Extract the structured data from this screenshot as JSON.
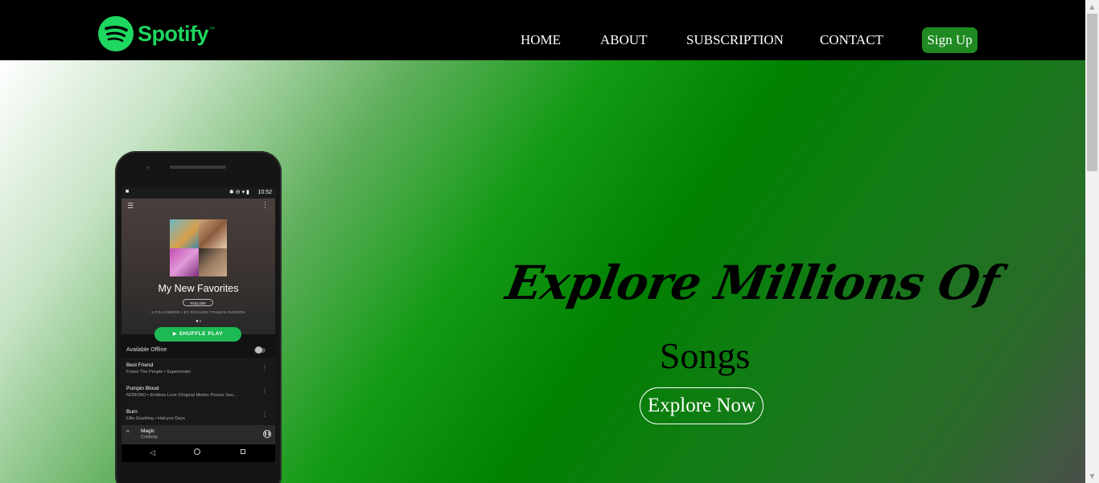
{
  "brand": {
    "name": "Spotify",
    "trademark": "™",
    "color": "#1ed760",
    "icon": "spotify-logo-icon"
  },
  "nav": {
    "links": [
      {
        "label": "HOME"
      },
      {
        "label": "ABOUT"
      },
      {
        "label": "SUBSCRIPTION"
      },
      {
        "label": "CONTACT"
      }
    ],
    "signup_label": "Sign Up",
    "signup_color": "#1f8a22"
  },
  "hero": {
    "title": "Explore Millions Of",
    "subtitle": "Songs",
    "cta_label": "Explore Now"
  },
  "phone": {
    "status_time": "10:52",
    "playlist_title": "My New Favorites",
    "follow_label": "FOLLOW",
    "playlist_meta": "5 FOLLOWERS • BY RICHARD TOLMAN-GARDON",
    "shuffle_label": "▶  SHUFFLE PLAY",
    "offline_label": "Available Offline",
    "tracks": [
      {
        "title": "Best Friend",
        "artist": "Foster The People • Supermodel"
      },
      {
        "title": "Pumpin Blood",
        "artist": "NONONO • Endless Love (Original Motion Picture Sou..."
      },
      {
        "title": "Burn",
        "artist": "Ellie Goulding • Halcyon Days"
      }
    ],
    "now_playing": {
      "title": "Magic",
      "artist": "Coldplay"
    },
    "accent_color": "#1db954"
  }
}
